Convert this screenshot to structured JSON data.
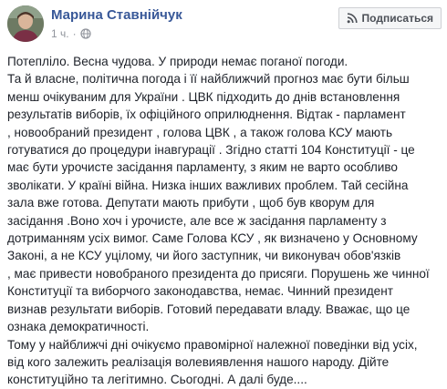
{
  "author": {
    "name": "Марина Ставнійчук"
  },
  "meta": {
    "time": "1 ч.",
    "separator": "·",
    "audience_icon": "globe-icon"
  },
  "subscribe_button": {
    "label": "Подписаться",
    "icon": "rss-icon"
  },
  "post": {
    "paragraphs": [
      "Потепліло. Весна чудова. У природи немає поганої погоди.",
      "Та й власне, політична погода і її найближчий прогноз має бути більш\nменш очікуваним для України . ЦВК підходить до днів встановлення\nрезультатів виборів, їх офіційного оприлюднення. Відтак - парламент\n, новообраний президент , голова ЦВК , а також голова КСУ мають\nготуватися до процедури інавгурації . Згідно статті 104 Конституції - це\nмає бути урочисте засідання парламенту, з яким не варто особливо\nзволікати. У країні війна. Низка інших важливих проблем. Тай сесійна\nзала вже готова. Депутати мають прибути , щоб був кворум для\nзасідання .Воно хоч і урочисте, але все ж засідання парламенту з\nдотриманням усіх вимог. Саме Голова КСУ , як визначено у Основному\nЗаконі, а не КСУ уцілому, чи його заступник, чи виконувач обов'язків\n, має привести новобраного президента до присяги. Порушень же чинної\nКонституції та виборчого законодавства, немає. Чинний президент\nвизнав результати виборів. Готовий передавати владу. Вважає, що це\nознака демократичності.",
      "Тому у найближчі дні очікуємо правомірної належної поведінки від усіх,\nвід кого залежить реалізація волевиявлення нашого народу. Дійте\nконституційно та легітимно. Сьогодні. А далі буде...."
    ]
  }
}
